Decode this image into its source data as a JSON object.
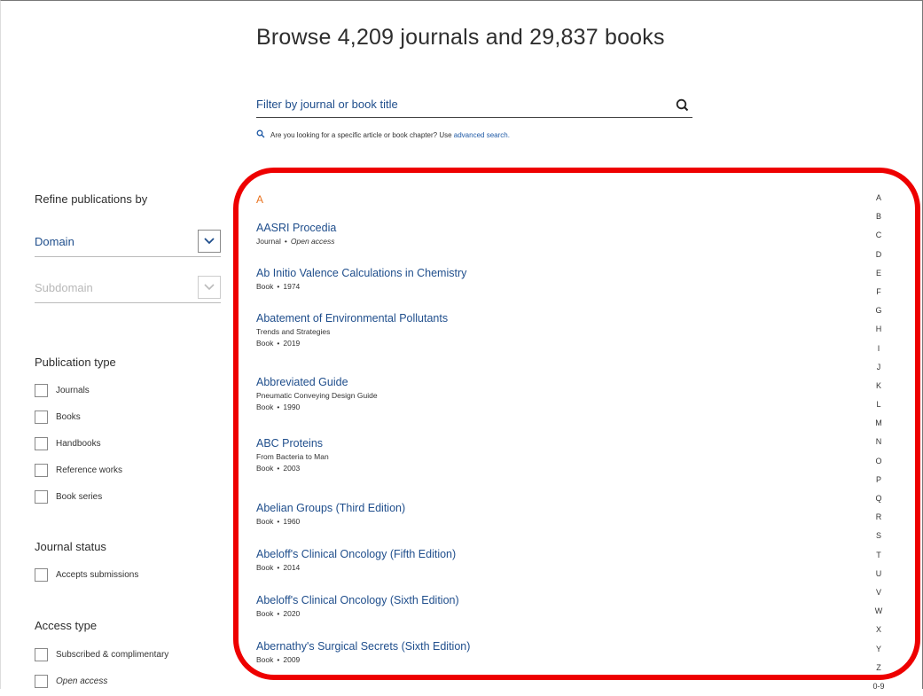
{
  "header": {
    "title": "Browse 4,209 journals and 29,837 books"
  },
  "search": {
    "placeholder": "Filter by journal or book title",
    "value": "",
    "hint_text": "Are you looking for a specific article or book chapter? Use",
    "hint_link": "advanced search."
  },
  "sidebar": {
    "refine_heading": "Refine publications by",
    "domain_label": "Domain",
    "subdomain_label": "Subdomain",
    "publication_type_heading": "Publication type",
    "publication_types": [
      "Journals",
      "Books",
      "Handbooks",
      "Reference works",
      "Book series"
    ],
    "journal_status_heading": "Journal status",
    "journal_status": [
      "Accepts submissions"
    ],
    "access_type_heading": "Access type",
    "access_types": [
      "Subscribed & complimentary",
      "Open access"
    ]
  },
  "results": {
    "letter": "A",
    "entries": [
      {
        "title": "AASRI Procedia",
        "subtitle": "",
        "type": "Journal",
        "detail": "Open access"
      },
      {
        "title": "Ab Initio Valence Calculations in Chemistry",
        "subtitle": "",
        "type": "Book",
        "detail": "1974"
      },
      {
        "title": "Abatement of Environmental Pollutants",
        "subtitle": "Trends and Strategies",
        "type": "Book",
        "detail": "2019"
      },
      {
        "title": "Abbreviated Guide",
        "subtitle": "Pneumatic Conveying Design Guide",
        "type": "Book",
        "detail": "1990"
      },
      {
        "title": "ABC Proteins",
        "subtitle": "From Bacteria to Man",
        "type": "Book",
        "detail": "2003"
      },
      {
        "title": "Abelian Groups (Third Edition)",
        "subtitle": "",
        "type": "Book",
        "detail": "1960"
      },
      {
        "title": "Abeloff's Clinical Oncology (Fifth Edition)",
        "subtitle": "",
        "type": "Book",
        "detail": "2014"
      },
      {
        "title": "Abeloff's Clinical Oncology (Sixth Edition)",
        "subtitle": "",
        "type": "Book",
        "detail": "2020"
      },
      {
        "title": "Abernathy's Surgical Secrets (Sixth Edition)",
        "subtitle": "",
        "type": "Book",
        "detail": "2009"
      }
    ],
    "separator": "•"
  },
  "alphabet": [
    "A",
    "B",
    "C",
    "D",
    "E",
    "F",
    "G",
    "H",
    "I",
    "J",
    "K",
    "L",
    "M",
    "N",
    "O",
    "P",
    "Q",
    "R",
    "S",
    "T",
    "U",
    "V",
    "W",
    "X",
    "Y",
    "Z",
    "0-9"
  ],
  "colors": {
    "link": "#1f4e8c",
    "accent_letter": "#e9711c",
    "annotation": "#ee0000"
  }
}
